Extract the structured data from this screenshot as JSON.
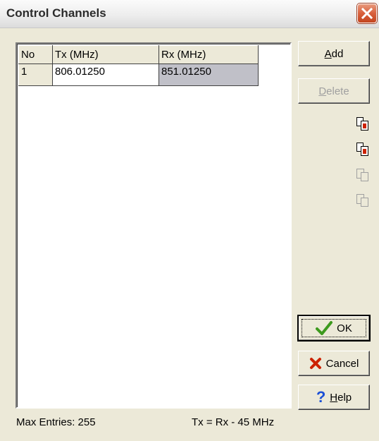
{
  "window": {
    "title": "Control Channels"
  },
  "grid": {
    "columns": [
      "No",
      "Tx (MHz)",
      "Rx (MHz)"
    ],
    "rows": [
      {
        "no": "1",
        "tx": "806.01250",
        "rx": "851.01250"
      }
    ]
  },
  "buttons": {
    "add": {
      "prefix": "",
      "mnemonic": "A",
      "suffix": "dd"
    },
    "delete": {
      "prefix": "",
      "mnemonic": "D",
      "suffix": "elete"
    },
    "ok": {
      "label": "OK"
    },
    "cancel": {
      "label": "Cancel"
    },
    "help": {
      "prefix": "",
      "mnemonic": "H",
      "suffix": "elp"
    }
  },
  "toolbar_icons": [
    "copy-tx-icon",
    "copy-rx-icon",
    "paste-tx-icon",
    "paste-rx-icon"
  ],
  "status": {
    "max_entries": "Max Entries: 255",
    "formula": "Tx = Rx - 45 MHz"
  },
  "colors": {
    "dialog_face": "#ece9d8",
    "selected_cell": "#c0c0c8",
    "close_button": "#d8603d",
    "ok_check": "#3d9a1e",
    "cancel_x": "#cc2200",
    "help_question": "#1a4fd6"
  }
}
